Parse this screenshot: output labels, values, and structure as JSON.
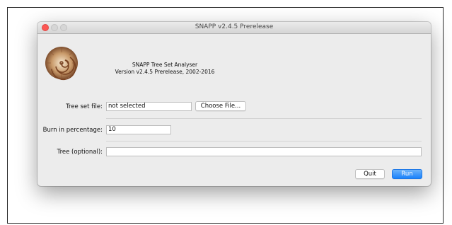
{
  "window": {
    "title": "SNAPP v2.4.5 Prerelease"
  },
  "header": {
    "app_name": "SNAPP Tree Set Analyser",
    "version_line": "Version v2.4.5 Prerelease, 2002-2016"
  },
  "form": {
    "tree_set_label": "Tree set file:",
    "tree_set_value": "not selected",
    "choose_file_label": "Choose File...",
    "burn_in_label": "Burn in percentage:",
    "burn_in_value": "10",
    "tree_label": "Tree (optional):",
    "tree_value": ""
  },
  "buttons": {
    "quit_label": "Quit",
    "run_label": "Run"
  },
  "colors": {
    "close_button": "#fc5753",
    "run_button": "#1a82fb",
    "window_bg": "#ececec"
  },
  "icons": {
    "logo": "shell-icon"
  }
}
